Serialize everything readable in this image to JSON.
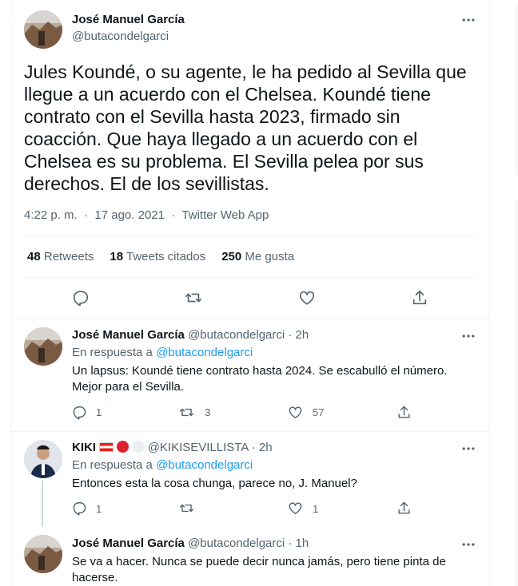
{
  "main_tweet": {
    "author_name": "José Manuel García",
    "author_handle": "@butacondelgarci",
    "text": "Jules Koundé, o su agente, le ha pedido al Sevilla que llegue a un acuerdo con el Chelsea. Koundé tiene contrato con el Sevilla hasta 2023, firmado sin coacción. Que haya llegado a un acuerdo con el Chelsea es su problema. El Sevilla pelea por sus derechos. El de los sevillistas.",
    "time": "4:22 p. m.",
    "date": "17 ago. 2021",
    "source": "Twitter Web App",
    "separator": "·",
    "stats": {
      "retweets_count": "48",
      "retweets_label": "Retweets",
      "quotes_count": "18",
      "quotes_label": "Tweets citados",
      "likes_count": "250",
      "likes_label": "Me gusta"
    }
  },
  "replies": [
    {
      "author_name": "José Manuel García",
      "author_handle": "@butacondelgarci",
      "time": "· 2h",
      "reply_to_label": "En respuesta a",
      "reply_to_handle": "@butacondelgarci",
      "text": "Un lapsus: Koundé tiene contrato hasta 2024. Se escabulló el número. Mejor para el Sevilla.",
      "reply_count": "1",
      "retweet_count": "3",
      "like_count": "57"
    },
    {
      "author_name": "KIKI",
      "author_handle": "@KIKISEVILLISTA",
      "time": "· 2h",
      "reply_to_label": "En respuesta a",
      "reply_to_handle": "@butacondelgarci",
      "text": "Entonces esta la cosa chunga, parece no, J. Manuel?",
      "reply_count": "1",
      "retweet_count": "",
      "like_count": "1"
    },
    {
      "author_name": "José Manuel García",
      "author_handle": "@butacondelgarci",
      "time": "· 1h",
      "text": "Se va a hacer. Nunca se puede decir nunca jamás, pero tiene pinta de hacerse."
    }
  ],
  "colors": {
    "text_primary": "#0f1419",
    "text_secondary": "#536471",
    "link": "#1d9bf0",
    "divider": "#eff3f4",
    "flag_red": "#e2231a",
    "circle_red": "#e0212e"
  },
  "icons": [
    "more-icon",
    "reply-icon",
    "retweet-icon",
    "like-icon",
    "share-icon"
  ]
}
